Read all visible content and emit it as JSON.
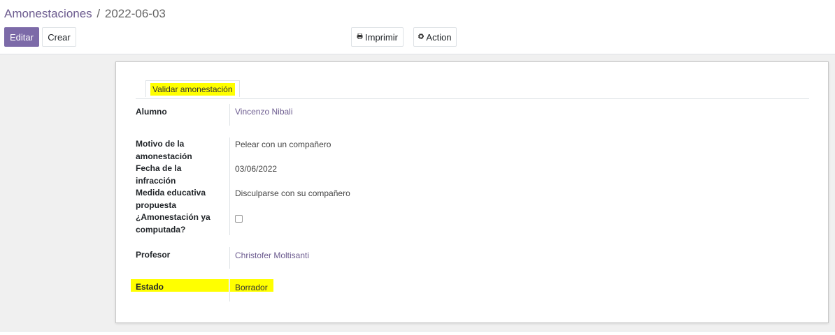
{
  "breadcrumb": {
    "parent": "Amonestaciones",
    "separator": "/",
    "current": "2022-06-03"
  },
  "toolbar": {
    "edit_label": "Editar",
    "create_label": "Crear",
    "print_label": "Imprimir",
    "print_icon": "print-icon",
    "action_label": "Action",
    "action_icon": "gear-icon"
  },
  "statusbar": {
    "button_label": "Validar amonestación",
    "highlight_color": "#ffff00"
  },
  "fields": {
    "alumno": {
      "label": "Alumno",
      "value": "Vincenzo Nibali"
    },
    "motivo": {
      "label_line1": "Motivo de la",
      "label_line2": "amonestación",
      "value": "Pelear con un compañero"
    },
    "fecha": {
      "label_line1": "Fecha de la",
      "label_line2": "infracción",
      "value": "03/06/2022"
    },
    "medida": {
      "label_line1": "Medida educativa",
      "label_line2": "propuesta",
      "value": "Disculparse con su compañero"
    },
    "computada": {
      "label_line1": "¿Amonestación ya",
      "label_line2": "computada?",
      "checked": false
    },
    "profesor": {
      "label": "Profesor",
      "value": "Christofer Moltisanti"
    },
    "estado": {
      "label": "Estado",
      "value": "Borrador"
    }
  },
  "colors": {
    "accent": "#7c6aa8",
    "link": "#6c5b8f",
    "highlight": "#ffff00"
  }
}
